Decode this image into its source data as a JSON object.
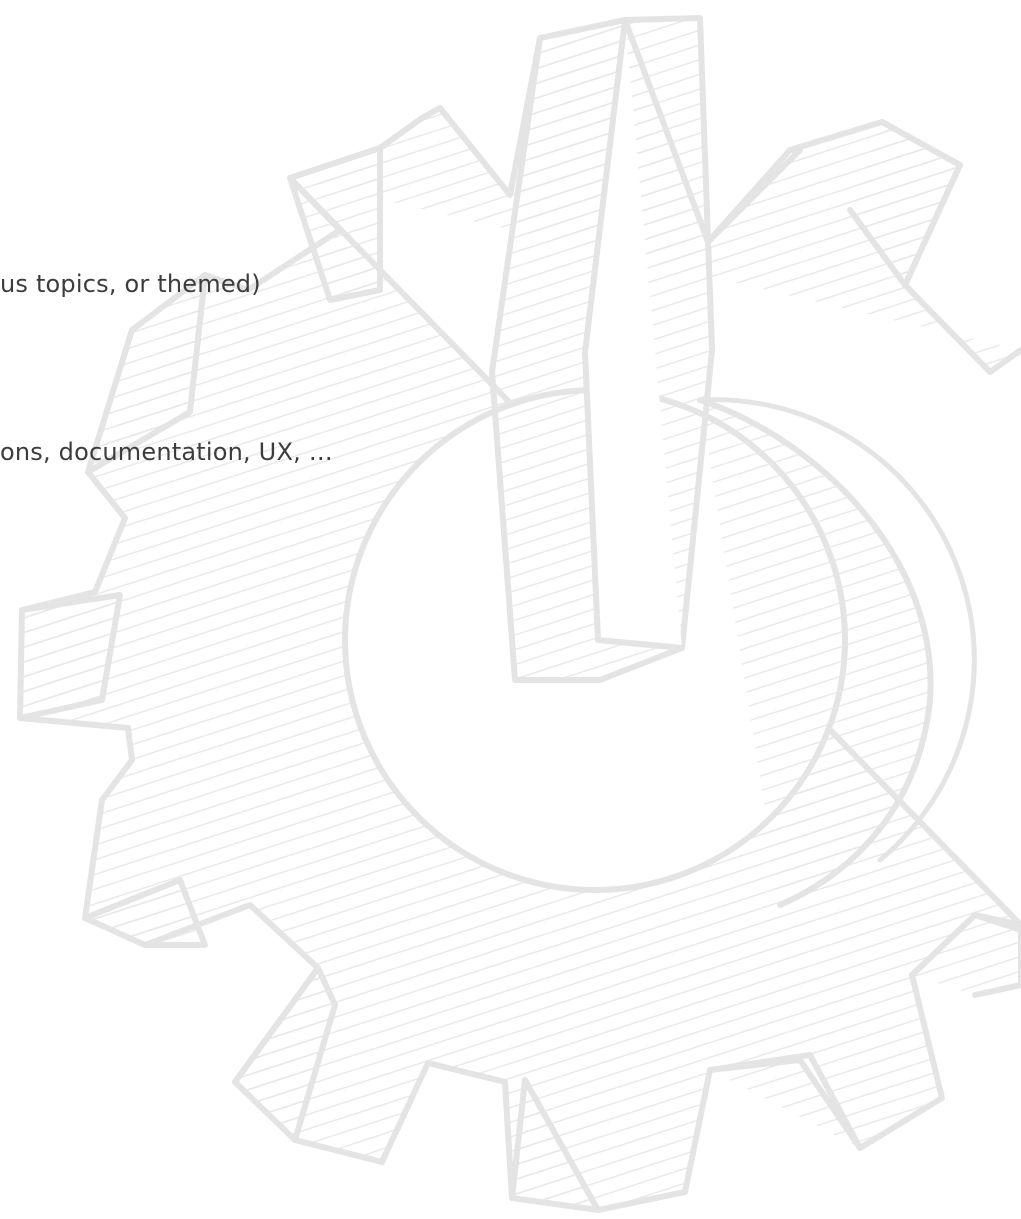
{
  "slide": {
    "lines": [
      "us topics, or themed)",
      "ons, documentation, UX, …"
    ]
  },
  "background": {
    "icon": "gear-power-icon",
    "stroke_color": "#e4e4e4"
  }
}
